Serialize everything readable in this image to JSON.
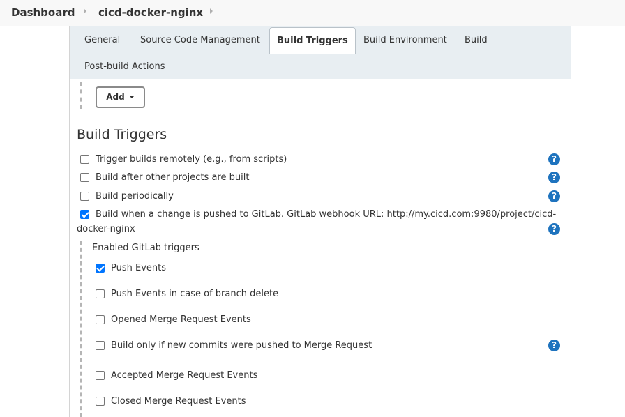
{
  "breadcrumb": {
    "home": "Dashboard",
    "job": "cicd-docker-nginx"
  },
  "tabs": [
    {
      "label": "General"
    },
    {
      "label": "Source Code Management"
    },
    {
      "label": "Build Triggers",
      "active": true
    },
    {
      "label": "Build Environment"
    },
    {
      "label": "Build"
    },
    {
      "label": "Post-build Actions"
    }
  ],
  "add_button": {
    "label": "Add"
  },
  "section": {
    "title": "Build Triggers"
  },
  "triggers": [
    {
      "label": "Trigger builds remotely (e.g., from scripts)",
      "checked": false
    },
    {
      "label": "Build after other projects are built",
      "checked": false
    },
    {
      "label": "Build periodically",
      "checked": false
    },
    {
      "label_line1": "Build when a change is pushed to GitLab. GitLab webhook URL: http://my.cicd.com:9980/project/cicd-",
      "label_line2": "docker-nginx",
      "checked": true
    }
  ],
  "gitlab": {
    "heading": "Enabled GitLab triggers",
    "options": [
      {
        "label": "Push Events",
        "checked": true
      },
      {
        "label": "Push Events in case of branch delete",
        "checked": false
      },
      {
        "label": "Opened Merge Request Events",
        "checked": false
      },
      {
        "label": "Build only if new commits were pushed to Merge Request",
        "checked": false
      },
      {
        "label": "Accepted Merge Request Events",
        "checked": false
      },
      {
        "label": "Closed Merge Request Events",
        "checked": false
      }
    ]
  },
  "help_glyph": "?",
  "colors": {
    "accent": "#0075ff",
    "help": "#1e73be",
    "tabbar": "#e8eef2"
  }
}
